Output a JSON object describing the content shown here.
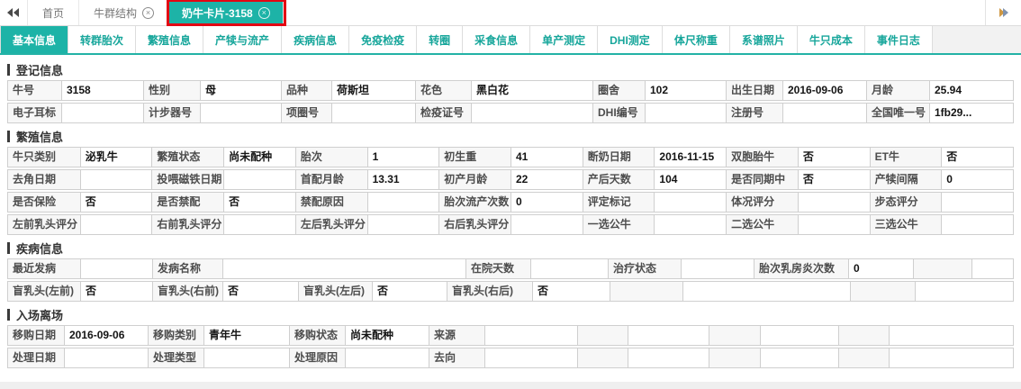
{
  "top_bar": {
    "back_icon": "double-left-arrow",
    "forward_icon": "double-right-arrow",
    "tabs": [
      {
        "label": "首页",
        "closable": false,
        "active": false,
        "highlighted": false
      },
      {
        "label": "牛群结构",
        "closable": true,
        "active": false,
        "highlighted": false
      },
      {
        "label": "奶牛卡片-3158",
        "closable": true,
        "active": true,
        "highlighted": true
      }
    ]
  },
  "sub_tab_bar": {
    "active": "基本信息",
    "tabs": [
      "基本信息",
      "转群胎次",
      "繁殖信息",
      "产犊与流产",
      "疾病信息",
      "免疫检疫",
      "转圈",
      "采食信息",
      "单产测定",
      "DHI测定",
      "体尺称重",
      "系谱照片",
      "牛只成本",
      "事件日志"
    ]
  },
  "colors": {
    "accent_teal": "#1db3a7",
    "highlight_red": "#e30613",
    "label_bg": "#f7f7f7",
    "border": "#cfcfcf"
  },
  "sections": [
    {
      "title": "登记信息",
      "rows": [
        [
          [
            "牛号",
            "3158"
          ],
          [
            "性别",
            "母"
          ],
          [
            "品种",
            "荷斯坦"
          ],
          [
            "花色",
            "黑白花"
          ],
          [
            "圈舍",
            "102"
          ],
          [
            "出生日期",
            "2016-09-06"
          ],
          [
            "月龄",
            "25.94"
          ]
        ],
        [
          [
            "电子耳标",
            ""
          ],
          [
            "计步器号",
            ""
          ],
          [
            "项圈号",
            ""
          ],
          [
            "检疫证号",
            ""
          ],
          [
            "DHI编号",
            ""
          ],
          [
            "注册号",
            ""
          ],
          [
            "全国唯一号",
            "1fb29..."
          ]
        ]
      ]
    },
    {
      "title": "繁殖信息",
      "rows": [
        [
          [
            "牛只类别",
            "泌乳牛"
          ],
          [
            "繁殖状态",
            "尚未配种"
          ],
          [
            "胎次",
            "1"
          ],
          [
            "初生重",
            "41"
          ],
          [
            "断奶日期",
            "2016-11-15"
          ],
          [
            "双胞胎牛",
            "否"
          ],
          [
            "ET牛",
            "否"
          ]
        ],
        [
          [
            "去角日期",
            ""
          ],
          [
            "投喂磁铁日期",
            ""
          ],
          [
            "首配月龄",
            "13.31"
          ],
          [
            "初产月龄",
            "22"
          ],
          [
            "产后天数",
            "104"
          ],
          [
            "是否同期中",
            "否"
          ],
          [
            "产犊间隔",
            "0"
          ]
        ],
        [
          [
            "是否保险",
            "否"
          ],
          [
            "是否禁配",
            "否"
          ],
          [
            "禁配原因",
            ""
          ],
          [
            "胎次流产次数",
            "0"
          ],
          [
            "评定标记",
            ""
          ],
          [
            "体况评分",
            ""
          ],
          [
            "步态评分",
            ""
          ]
        ],
        [
          [
            "左前乳头评分",
            ""
          ],
          [
            "右前乳头评分",
            ""
          ],
          [
            "左后乳头评分",
            ""
          ],
          [
            "右后乳头评分",
            ""
          ],
          [
            "一选公牛",
            ""
          ],
          [
            "二选公牛",
            ""
          ],
          [
            "三选公牛",
            ""
          ]
        ]
      ]
    },
    {
      "title": "疾病信息",
      "rows": [
        [
          [
            "最近发病",
            ""
          ],
          [
            "发病名称",
            ""
          ],
          [
            "在院天数",
            ""
          ],
          [
            "治疗状态",
            ""
          ],
          [
            "胎次乳房炎次数",
            "0"
          ],
          [
            "",
            ""
          ]
        ],
        [
          [
            "盲乳头(左前)",
            "否"
          ],
          [
            "盲乳头(右前)",
            "否"
          ],
          [
            "盲乳头(左后)",
            "否"
          ],
          [
            "盲乳头(右后)",
            "否"
          ],
          [
            "",
            ""
          ],
          [
            "",
            ""
          ]
        ]
      ]
    },
    {
      "title": "入场离场",
      "rows": [
        [
          [
            "移购日期",
            "2016-09-06"
          ],
          [
            "移购类别",
            "青年牛"
          ],
          [
            "移购状态",
            "尚未配种"
          ],
          [
            "来源",
            ""
          ],
          [
            "",
            ""
          ],
          [
            "",
            ""
          ],
          [
            "",
            ""
          ]
        ],
        [
          [
            "处理日期",
            ""
          ],
          [
            "处理类型",
            ""
          ],
          [
            "处理原因",
            ""
          ],
          [
            "去向",
            ""
          ],
          [
            "",
            ""
          ],
          [
            "",
            ""
          ],
          [
            "",
            ""
          ]
        ]
      ]
    }
  ]
}
